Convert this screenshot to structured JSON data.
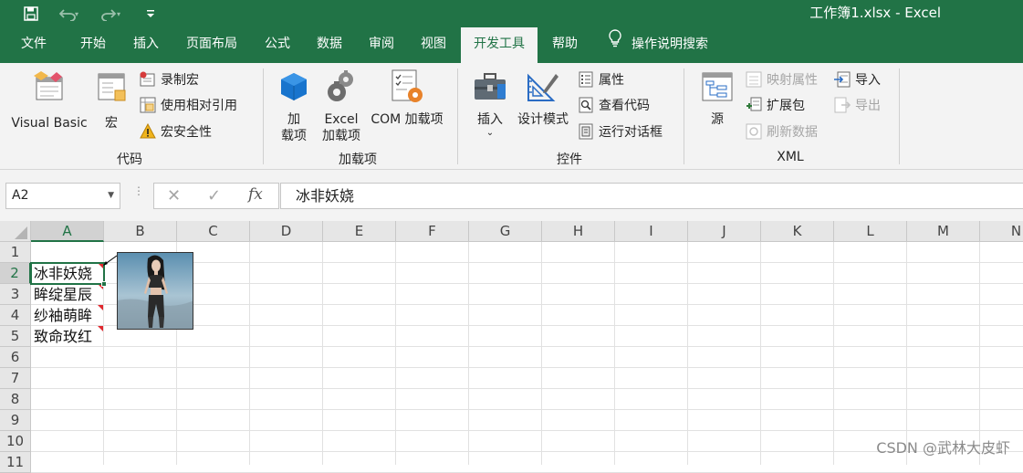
{
  "titlebar": {
    "title": "工作簿1.xlsx  -  Excel",
    "save_icon": "save-icon",
    "undo_icon": "undo-icon",
    "redo_icon": "redo-icon",
    "customize_icon": "customize-icon"
  },
  "tabs": [
    {
      "label": "文件"
    },
    {
      "label": "开始"
    },
    {
      "label": "插入"
    },
    {
      "label": "页面布局"
    },
    {
      "label": "公式"
    },
    {
      "label": "数据"
    },
    {
      "label": "审阅"
    },
    {
      "label": "视图"
    },
    {
      "label": "开发工具",
      "active": true
    },
    {
      "label": "帮助"
    },
    {
      "label": "操作说明搜索",
      "icon": "lightbulb-icon"
    }
  ],
  "ribbon": {
    "code": {
      "label": "代码",
      "visual_basic": "Visual Basic",
      "macros": "宏",
      "record_macro": "录制宏",
      "relative_ref": "使用相对引用",
      "macro_security": "宏安全性"
    },
    "addins": {
      "label": "加载项",
      "addins_line1": "加",
      "addins_line2": "载项",
      "excel_addins_line1": "Excel",
      "excel_addins_line2": "加载项",
      "com_addins": "COM 加载项"
    },
    "controls": {
      "label": "控件",
      "insert": "插入",
      "design_mode": "设计模式",
      "properties": "属性",
      "view_code": "查看代码",
      "run_dialog": "运行对话框"
    },
    "xml": {
      "label": "XML",
      "source": "源",
      "map_properties": "映射属性",
      "expansion_packs": "扩展包",
      "refresh_data": "刷新数据",
      "import": "导入",
      "export": "导出"
    }
  },
  "formula_bar": {
    "name_box": "A2",
    "formula": "冰非妖娆",
    "cancel_icon": "cancel-icon",
    "enter_icon": "check-icon",
    "fx": "fx"
  },
  "sheet": {
    "columns": [
      "A",
      "B",
      "C",
      "D",
      "E",
      "F",
      "G",
      "H",
      "I",
      "J",
      "K",
      "L",
      "M",
      "N"
    ],
    "rows": [
      "1",
      "2",
      "3",
      "4",
      "5",
      "6",
      "7",
      "8",
      "9",
      "10",
      "11"
    ],
    "cells": {
      "A2": "冰非妖娆",
      "A3": "眸绽星辰",
      "A4": "纱袖萌眸",
      "A5": "致命玫红"
    },
    "selected_cell": "A2"
  },
  "watermark": "CSDN @武林大皮虾"
}
